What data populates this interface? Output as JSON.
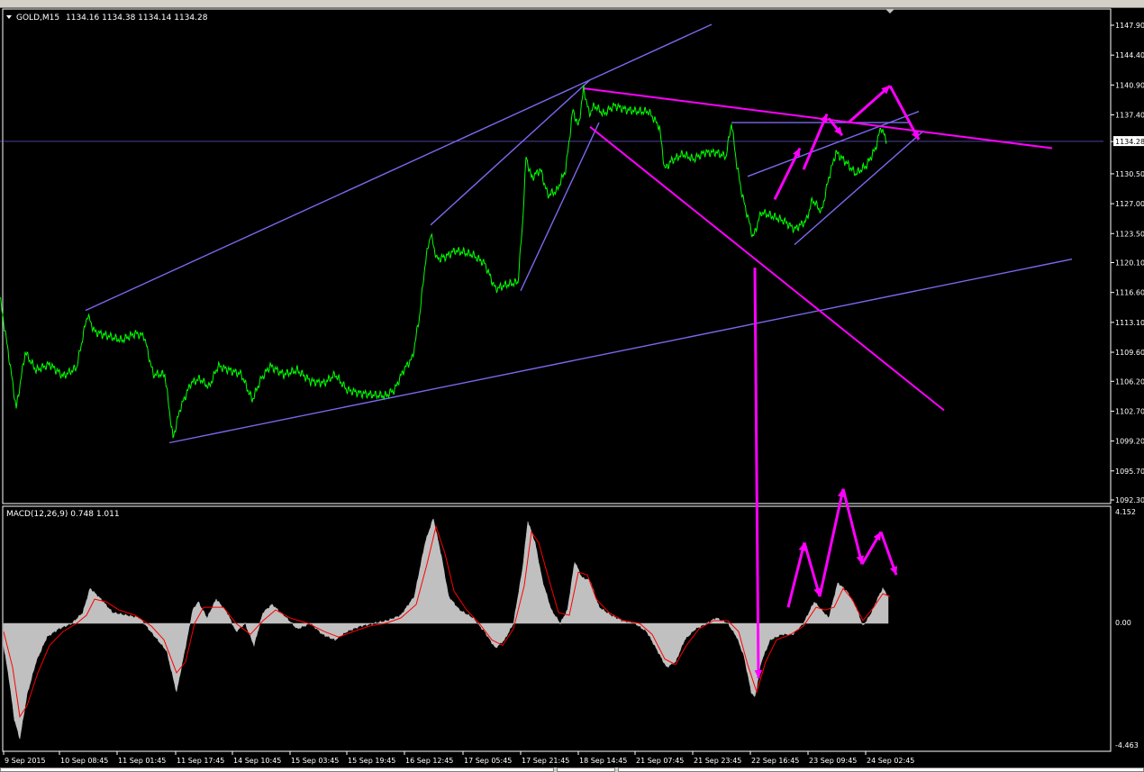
{
  "window": {
    "symbol_label": "GOLD,M15",
    "ohlc": "1134.16 1134.38 1134.14 1134.28"
  },
  "toolbar": {
    "icons": [
      "new-chart-icon",
      "open-icon",
      "save-icon",
      "play-icon",
      "add-icon",
      "profile-icon",
      "window-icon",
      "crosshair-icon",
      "line-icon",
      "period-icon"
    ]
  },
  "colors": {
    "background": "#000000",
    "price": "#00ff00",
    "channel": "#7b68ee",
    "annotation": "#ff00ff",
    "axis": "#ffffff",
    "macd_hist": "#c0c0c0",
    "macd_signal": "#ff0000"
  },
  "price_axis": {
    "labels": [
      "1147.90",
      "1144.40",
      "1140.90",
      "1137.40",
      "1134.28",
      "1130.50",
      "1127.00",
      "1123.50",
      "1120.10",
      "1116.60",
      "1113.10",
      "1109.60",
      "1106.20",
      "1102.70",
      "1099.20",
      "1095.70",
      "1092.30"
    ],
    "current": "1134.28"
  },
  "macd_panel": {
    "label": "MACD(12,26,9) 0.748 1.011",
    "axis_top": "4.152",
    "axis_zero": "0.00",
    "axis_bottom": "-4.463"
  },
  "time_axis": {
    "labels": [
      "9 Sep 2015",
      "10 Sep 08:45",
      "11 Sep 01:45",
      "11 Sep 17:45",
      "14 Sep 10:45",
      "15 Sep 03:45",
      "15 Sep 19:45",
      "16 Sep 12:45",
      "17 Sep 05:45",
      "17 Sep 21:45",
      "18 Sep 14:45",
      "21 Sep 07:45",
      "21 Sep 23:45",
      "22 Sep 16:45",
      "23 Sep 09:45",
      "24 Sep 02:45"
    ]
  },
  "chart_data": {
    "type": "line",
    "symbol": "GOLD",
    "timeframe": "M15",
    "y_range": [
      1091.0,
      1149.0
    ],
    "price_points": [
      [
        0,
        1116.0
      ],
      [
        10,
        1109.0
      ],
      [
        18,
        1103.0
      ],
      [
        28,
        1109.6
      ],
      [
        40,
        1107.5
      ],
      [
        55,
        1108.2
      ],
      [
        70,
        1106.8
      ],
      [
        85,
        1107.8
      ],
      [
        97,
        1114.0
      ],
      [
        105,
        1112.0
      ],
      [
        120,
        1111.5
      ],
      [
        135,
        1111.0
      ],
      [
        150,
        1111.8
      ],
      [
        160,
        1111.5
      ],
      [
        170,
        1107.0
      ],
      [
        183,
        1107.0
      ],
      [
        192,
        1099.5
      ],
      [
        200,
        1103.0
      ],
      [
        212,
        1106.0
      ],
      [
        222,
        1106.5
      ],
      [
        232,
        1105.5
      ],
      [
        242,
        1108.0
      ],
      [
        255,
        1107.5
      ],
      [
        268,
        1107.0
      ],
      [
        280,
        1104.0
      ],
      [
        290,
        1106.5
      ],
      [
        300,
        1108.0
      ],
      [
        315,
        1107.0
      ],
      [
        330,
        1107.5
      ],
      [
        345,
        1106.2
      ],
      [
        360,
        1106.0
      ],
      [
        372,
        1107.0
      ],
      [
        385,
        1105.2
      ],
      [
        400,
        1104.8
      ],
      [
        415,
        1104.6
      ],
      [
        428,
        1104.5
      ],
      [
        438,
        1105.2
      ],
      [
        448,
        1107.5
      ],
      [
        458,
        1109.0
      ],
      [
        466,
        1114.0
      ],
      [
        472,
        1120.0
      ],
      [
        478,
        1123.5
      ],
      [
        485,
        1120.5
      ],
      [
        495,
        1120.8
      ],
      [
        505,
        1121.5
      ],
      [
        515,
        1121.3
      ],
      [
        525,
        1121.0
      ],
      [
        538,
        1120.0
      ],
      [
        550,
        1117.0
      ],
      [
        562,
        1117.5
      ],
      [
        575,
        1117.8
      ],
      [
        580,
        1124.5
      ],
      [
        584,
        1132.5
      ],
      [
        590,
        1130.0
      ],
      [
        600,
        1131.0
      ],
      [
        608,
        1128.0
      ],
      [
        618,
        1128.5
      ],
      [
        628,
        1131.0
      ],
      [
        636,
        1138.0
      ],
      [
        642,
        1136.0
      ],
      [
        648,
        1140.5
      ],
      [
        654,
        1137.5
      ],
      [
        660,
        1138.5
      ],
      [
        670,
        1137.5
      ],
      [
        682,
        1138.5
      ],
      [
        695,
        1138.0
      ],
      [
        708,
        1137.8
      ],
      [
        720,
        1137.8
      ],
      [
        732,
        1136.0
      ],
      [
        738,
        1131.0
      ],
      [
        745,
        1132.0
      ],
      [
        758,
        1132.8
      ],
      [
        770,
        1132.2
      ],
      [
        782,
        1133.0
      ],
      [
        795,
        1133.0
      ],
      [
        806,
        1132.5
      ],
      [
        812,
        1136.5
      ],
      [
        818,
        1131.5
      ],
      [
        824,
        1128.0
      ],
      [
        830,
        1125.5
      ],
      [
        836,
        1123.0
      ],
      [
        845,
        1126.0
      ],
      [
        858,
        1125.5
      ],
      [
        870,
        1125.0
      ],
      [
        882,
        1124.0
      ],
      [
        895,
        1125.0
      ],
      [
        902,
        1127.5
      ],
      [
        912,
        1126.0
      ],
      [
        920,
        1130.0
      ],
      [
        928,
        1133.0
      ],
      [
        938,
        1132.0
      ],
      [
        950,
        1130.5
      ],
      [
        962,
        1131.5
      ],
      [
        972,
        1133.5
      ],
      [
        978,
        1136.0
      ],
      [
        984,
        1134.3
      ]
    ],
    "macd_range": [
      -4.463,
      4.152
    ],
    "macd_points": [
      [
        4,
        -0.8
      ],
      [
        10,
        -2.0
      ],
      [
        16,
        -3.5
      ],
      [
        22,
        -4.2
      ],
      [
        30,
        -2.6
      ],
      [
        40,
        -1.4
      ],
      [
        52,
        -0.5
      ],
      [
        65,
        -0.2
      ],
      [
        80,
        0.0
      ],
      [
        92,
        0.4
      ],
      [
        100,
        1.3
      ],
      [
        112,
        0.9
      ],
      [
        125,
        0.4
      ],
      [
        140,
        0.3
      ],
      [
        155,
        0.2
      ],
      [
        170,
        -0.4
      ],
      [
        185,
        -1.0
      ],
      [
        196,
        -2.5
      ],
      [
        205,
        -1.0
      ],
      [
        214,
        0.5
      ],
      [
        220,
        0.8
      ],
      [
        230,
        0.2
      ],
      [
        240,
        0.9
      ],
      [
        252,
        0.4
      ],
      [
        262,
        -0.3
      ],
      [
        272,
        0.0
      ],
      [
        282,
        -0.8
      ],
      [
        292,
        0.4
      ],
      [
        302,
        0.7
      ],
      [
        315,
        0.3
      ],
      [
        330,
        -0.2
      ],
      [
        345,
        0.0
      ],
      [
        358,
        -0.4
      ],
      [
        372,
        -0.6
      ],
      [
        385,
        -0.3
      ],
      [
        400,
        -0.1
      ],
      [
        415,
        0.0
      ],
      [
        430,
        0.1
      ],
      [
        445,
        0.3
      ],
      [
        460,
        1.0
      ],
      [
        472,
        3.0
      ],
      [
        481,
        3.9
      ],
      [
        490,
        2.5
      ],
      [
        498,
        1.0
      ],
      [
        510,
        0.5
      ],
      [
        525,
        0.2
      ],
      [
        538,
        -0.3
      ],
      [
        550,
        -0.9
      ],
      [
        560,
        -0.6
      ],
      [
        570,
        0.0
      ],
      [
        580,
        2.0
      ],
      [
        586,
        3.8
      ],
      [
        594,
        3.0
      ],
      [
        602,
        1.6
      ],
      [
        612,
        0.5
      ],
      [
        622,
        0.0
      ],
      [
        630,
        0.5
      ],
      [
        638,
        2.3
      ],
      [
        646,
        1.7
      ],
      [
        655,
        1.6
      ],
      [
        665,
        0.6
      ],
      [
        678,
        0.3
      ],
      [
        690,
        0.1
      ],
      [
        705,
        0.0
      ],
      [
        718,
        -0.3
      ],
      [
        730,
        -1.0
      ],
      [
        740,
        -1.6
      ],
      [
        750,
        -1.4
      ],
      [
        760,
        -0.6
      ],
      [
        772,
        -0.2
      ],
      [
        785,
        0.0
      ],
      [
        795,
        0.2
      ],
      [
        808,
        0.0
      ],
      [
        818,
        -0.5
      ],
      [
        826,
        -1.2
      ],
      [
        834,
        -2.5
      ],
      [
        838,
        -2.7
      ],
      [
        845,
        -1.4
      ],
      [
        855,
        -0.6
      ],
      [
        868,
        -0.4
      ],
      [
        880,
        -0.4
      ],
      [
        892,
        0.0
      ],
      [
        904,
        0.8
      ],
      [
        912,
        0.5
      ],
      [
        920,
        0.2
      ],
      [
        930,
        1.5
      ],
      [
        940,
        1.2
      ],
      [
        950,
        0.6
      ],
      [
        958,
        -0.1
      ],
      [
        966,
        0.3
      ],
      [
        974,
        0.9
      ],
      [
        980,
        1.3
      ],
      [
        986,
        1.0
      ]
    ],
    "macd_signal_points": [
      [
        4,
        -0.3
      ],
      [
        14,
        -1.6
      ],
      [
        22,
        -3.4
      ],
      [
        30,
        -3.0
      ],
      [
        42,
        -1.8
      ],
      [
        55,
        -0.8
      ],
      [
        70,
        -0.3
      ],
      [
        85,
        0.0
      ],
      [
        96,
        0.3
      ],
      [
        105,
        0.9
      ],
      [
        118,
        0.8
      ],
      [
        132,
        0.5
      ],
      [
        150,
        0.3
      ],
      [
        168,
        -0.1
      ],
      [
        182,
        -0.6
      ],
      [
        196,
        -1.8
      ],
      [
        206,
        -1.4
      ],
      [
        216,
        0.0
      ],
      [
        226,
        0.6
      ],
      [
        236,
        0.6
      ],
      [
        248,
        0.6
      ],
      [
        262,
        0.0
      ],
      [
        278,
        -0.4
      ],
      [
        292,
        0.1
      ],
      [
        306,
        0.5
      ],
      [
        322,
        0.2
      ],
      [
        342,
        0.0
      ],
      [
        360,
        -0.3
      ],
      [
        376,
        -0.5
      ],
      [
        392,
        -0.3
      ],
      [
        410,
        -0.1
      ],
      [
        428,
        0.0
      ],
      [
        445,
        0.2
      ],
      [
        462,
        0.7
      ],
      [
        474,
        2.2
      ],
      [
        484,
        3.6
      ],
      [
        494,
        2.6
      ],
      [
        504,
        1.2
      ],
      [
        518,
        0.5
      ],
      [
        532,
        0.0
      ],
      [
        546,
        -0.6
      ],
      [
        558,
        -0.8
      ],
      [
        570,
        -0.2
      ],
      [
        582,
        1.4
      ],
      [
        590,
        3.4
      ],
      [
        598,
        3.0
      ],
      [
        608,
        1.8
      ],
      [
        620,
        0.4
      ],
      [
        632,
        0.3
      ],
      [
        642,
        1.9
      ],
      [
        652,
        1.8
      ],
      [
        662,
        0.9
      ],
      [
        676,
        0.4
      ],
      [
        692,
        0.1
      ],
      [
        710,
        0.0
      ],
      [
        724,
        -0.4
      ],
      [
        738,
        -1.3
      ],
      [
        750,
        -1.5
      ],
      [
        762,
        -0.8
      ],
      [
        776,
        -0.2
      ],
      [
        792,
        0.1
      ],
      [
        808,
        0.1
      ],
      [
        820,
        -0.3
      ],
      [
        830,
        -1.5
      ],
      [
        840,
        -2.5
      ],
      [
        850,
        -1.4
      ],
      [
        862,
        -0.6
      ],
      [
        878,
        -0.4
      ],
      [
        892,
        -0.1
      ],
      [
        906,
        0.6
      ],
      [
        916,
        0.5
      ],
      [
        926,
        0.6
      ],
      [
        936,
        1.3
      ],
      [
        946,
        0.9
      ],
      [
        958,
        0.1
      ],
      [
        970,
        0.6
      ],
      [
        980,
        1.1
      ],
      [
        988,
        1.0
      ]
    ],
    "trend_lines": [
      {
        "color": "channel",
        "from": [
          95,
          1114.5
        ],
        "to": [
          790,
          1148.0
        ]
      },
      {
        "color": "channel",
        "from": [
          188,
          1099.0
        ],
        "to": [
          1190,
          1120.5
        ]
      },
      {
        "color": "channel",
        "from": [
          478,
          1124.5
        ],
        "to": [
          655,
          1141.5
        ]
      },
      {
        "color": "channel",
        "from": [
          578,
          1116.8
        ],
        "to": [
          665,
          1136.5
        ]
      },
      {
        "color": "channel",
        "from": [
          812,
          1136.5
        ],
        "to": [
          1010,
          1136.5
        ]
      },
      {
        "color": "channel",
        "from": [
          830,
          1130.2
        ],
        "to": [
          1020,
          1137.8
        ]
      },
      {
        "color": "channel",
        "from": [
          882,
          1122.2
        ],
        "to": [
          1025,
          1135.5
        ]
      },
      {
        "color": "channel",
        "from": [
          0,
          1134.3
        ],
        "to": [
          1225,
          1134.3
        ]
      },
      {
        "color": "annotation",
        "from": [
          648,
          1140.5
        ],
        "to": [
          1168,
          1133.5
        ]
      },
      {
        "color": "annotation",
        "from": [
          655,
          1136.0
        ],
        "to": [
          1048,
          1102.8
        ]
      }
    ],
    "annotation_arrows": [
      {
        "pane": "price",
        "points": [
          [
            860,
            1127.5
          ],
          [
            888,
            1133.5
          ]
        ]
      },
      {
        "pane": "price",
        "points": [
          [
            892,
            1131.0
          ],
          [
            918,
            1137.5
          ]
        ]
      },
      {
        "pane": "price",
        "points": [
          [
            920,
            1137.0
          ],
          [
            935,
            1135.0
          ]
        ]
      },
      {
        "pane": "price",
        "points": [
          [
            942,
            1136.5
          ],
          [
            988,
            1140.8
          ]
        ]
      },
      {
        "pane": "price",
        "points": [
          [
            988,
            1140.8
          ],
          [
            1020,
            1134.5
          ]
        ]
      },
      {
        "pane": "macd",
        "points": [
          [
            875,
            0.6
          ],
          [
            893,
            3.0
          ]
        ]
      },
      {
        "pane": "macd",
        "points": [
          [
            893,
            3.0
          ],
          [
            910,
            1.0
          ]
        ]
      },
      {
        "pane": "macd",
        "points": [
          [
            910,
            1.0
          ],
          [
            936,
            5.0
          ]
        ]
      },
      {
        "pane": "macd",
        "points": [
          [
            936,
            5.0
          ],
          [
            957,
            2.2
          ]
        ]
      },
      {
        "pane": "macd",
        "points": [
          [
            957,
            2.2
          ],
          [
            978,
            3.4
          ]
        ]
      },
      {
        "pane": "macd",
        "points": [
          [
            978,
            3.4
          ],
          [
            995,
            1.8
          ]
        ]
      }
    ],
    "long_arrow": {
      "x": 838,
      "from_price": 1119.5,
      "to_macd": -2.0
    }
  }
}
